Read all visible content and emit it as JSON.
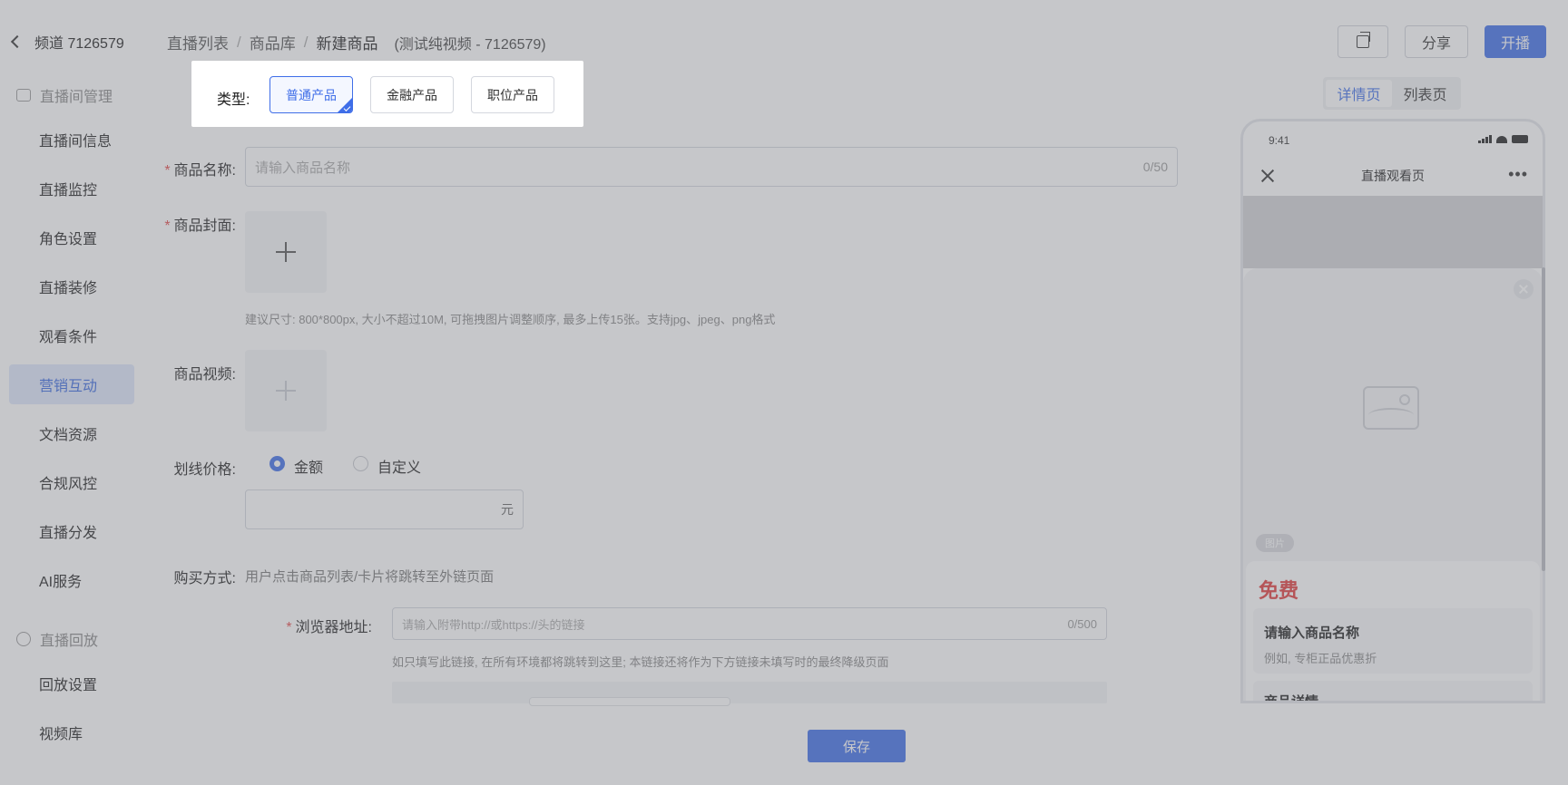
{
  "sidebar": {
    "channel": "频道 7126579",
    "group_live": "直播间管理",
    "items": [
      "直播间信息",
      "直播监控",
      "角色设置",
      "直播装修",
      "观看条件",
      "营销互动",
      "文档资源",
      "合规风控",
      "直播分发",
      "AI服务"
    ],
    "group_replay": "直播回放",
    "replay_items": [
      "回放设置",
      "视频库"
    ]
  },
  "breadcrumb": {
    "item1": "直播列表",
    "item2": "商品库",
    "current": "新建商品",
    "subtitle": "(测试纯视频 - 7126579)"
  },
  "toolbar": {
    "share_label": "分享",
    "live_label": "开播"
  },
  "form": {
    "type_label": "类型:",
    "types": [
      "普通产品",
      "金融产品",
      "职位产品"
    ],
    "name_label": "商品名称:",
    "name_placeholder": "请输入商品名称",
    "name_counter": "0/50",
    "cover_label": "商品封面:",
    "cover_hint": "建议尺寸: 800*800px, 大小不超过10M, 可拖拽图片调整顺序, 最多上传15张。支持jpg、jpeg、png格式",
    "video_label": "商品视频:",
    "price_label": "划线价格:",
    "price_opt1": "金额",
    "price_opt2": "自定义",
    "price_unit": "元",
    "buy_label": "购买方式:",
    "buy_text": "用户点击商品列表/卡片将跳转至外链页面",
    "url_label": "浏览器地址:",
    "url_placeholder": "请输入附带http://或https://头的链接",
    "url_counter": "0/500",
    "url_hint": "如只填写此链接, 在所有环境都将跳转到这里; 本链接还将作为下方链接未填写时的最终降级页面",
    "save_label": "保存"
  },
  "preview": {
    "tab_detail": "详情页",
    "tab_list": "列表页",
    "time": "9:41",
    "nav_title": "直播观看页",
    "image_tag": "图片",
    "free": "免费",
    "name_title": "请输入商品名称",
    "name_sub": "例如, 专柜正品优惠折",
    "detail_title": "商品详情"
  },
  "colors": {
    "primary": "#3f6ee8",
    "price": "#e23b3b"
  }
}
